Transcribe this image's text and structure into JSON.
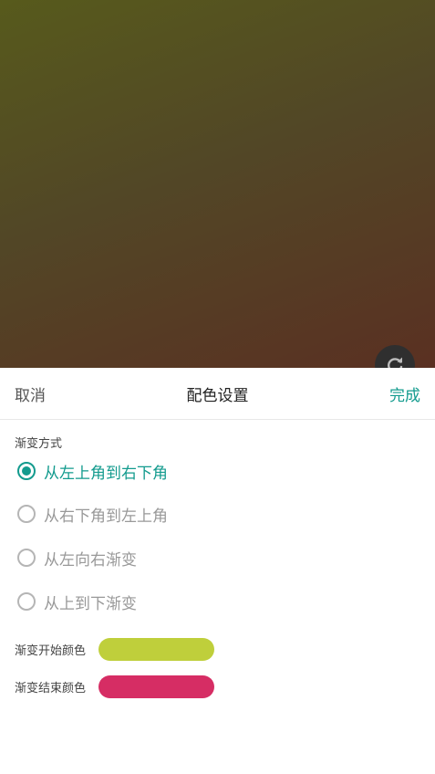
{
  "header": {
    "cancel_label": "取消",
    "title": "配色设置",
    "done_label": "完成"
  },
  "gradient_section": {
    "label": "渐变方式",
    "options": [
      {
        "label": "从左上角到右下角",
        "checked": true
      },
      {
        "label": "从右下角到左上角",
        "checked": false
      },
      {
        "label": "从左向右渐变",
        "checked": false
      },
      {
        "label": "从上到下渐变",
        "checked": false
      }
    ]
  },
  "colors": {
    "start_label": "渐变开始颜色",
    "start_color": "#bfcf3b",
    "end_label": "渐变结束颜色",
    "end_color": "#d62d64"
  },
  "preview": {
    "gradient_start": "#575a1c",
    "gradient_end": "#5a3022",
    "refresh_icon": "refresh-icon"
  },
  "theme": {
    "accent": "#139b8e"
  }
}
